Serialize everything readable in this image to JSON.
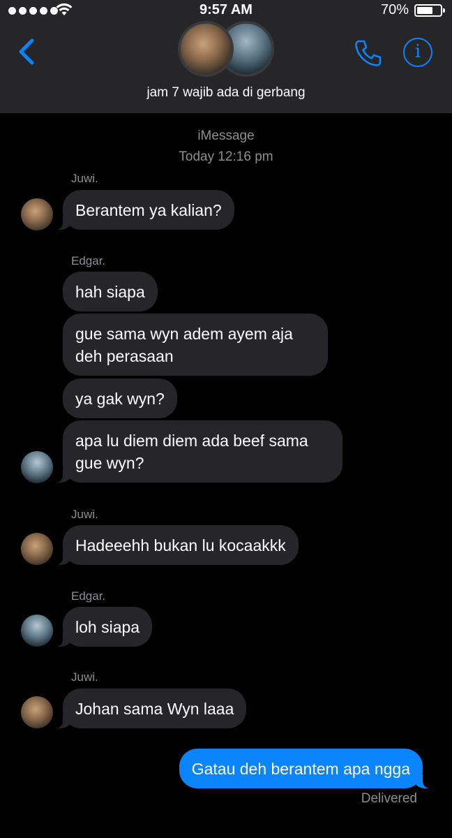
{
  "status_bar": {
    "time": "9:57 AM",
    "battery_percent": "70%",
    "battery_level": 0.7,
    "signal_bars": 5
  },
  "header": {
    "group_name": "jam 7 wajib ada di gerbang",
    "back_icon": "chevron-left-icon",
    "call_icon": "phone-icon",
    "info_icon": "info-icon",
    "info_glyph": "i"
  },
  "conversation": {
    "service_label": "iMessage",
    "timestamp": "Today 12:16 pm",
    "blocks": [
      {
        "sender": "Juwi.",
        "messages": [
          "Berantem ya kalian?"
        ]
      },
      {
        "sender": "Edgar.",
        "messages": [
          "hah siapa",
          "gue sama wyn adem ayem aja deh perasaan",
          "ya gak wyn?",
          "apa lu diem diem ada beef sama gue wyn?"
        ]
      },
      {
        "sender": "Juwi.",
        "messages": [
          "Hadeeehh bukan lu kocaakkk"
        ]
      },
      {
        "sender": "Edgar.",
        "messages": [
          "loh siapa"
        ]
      },
      {
        "sender": "Juwi.",
        "messages": [
          "Johan sama Wyn laaa"
        ]
      }
    ],
    "outgoing": {
      "text": "Gatau deh berantem apa ngga",
      "status": "Delivered"
    }
  },
  "colors": {
    "accent": "#0a84ff",
    "incoming_bubble": "#26252a",
    "header_bg": "#262628",
    "meta_text": "#8e8e93",
    "background": "#000000"
  }
}
